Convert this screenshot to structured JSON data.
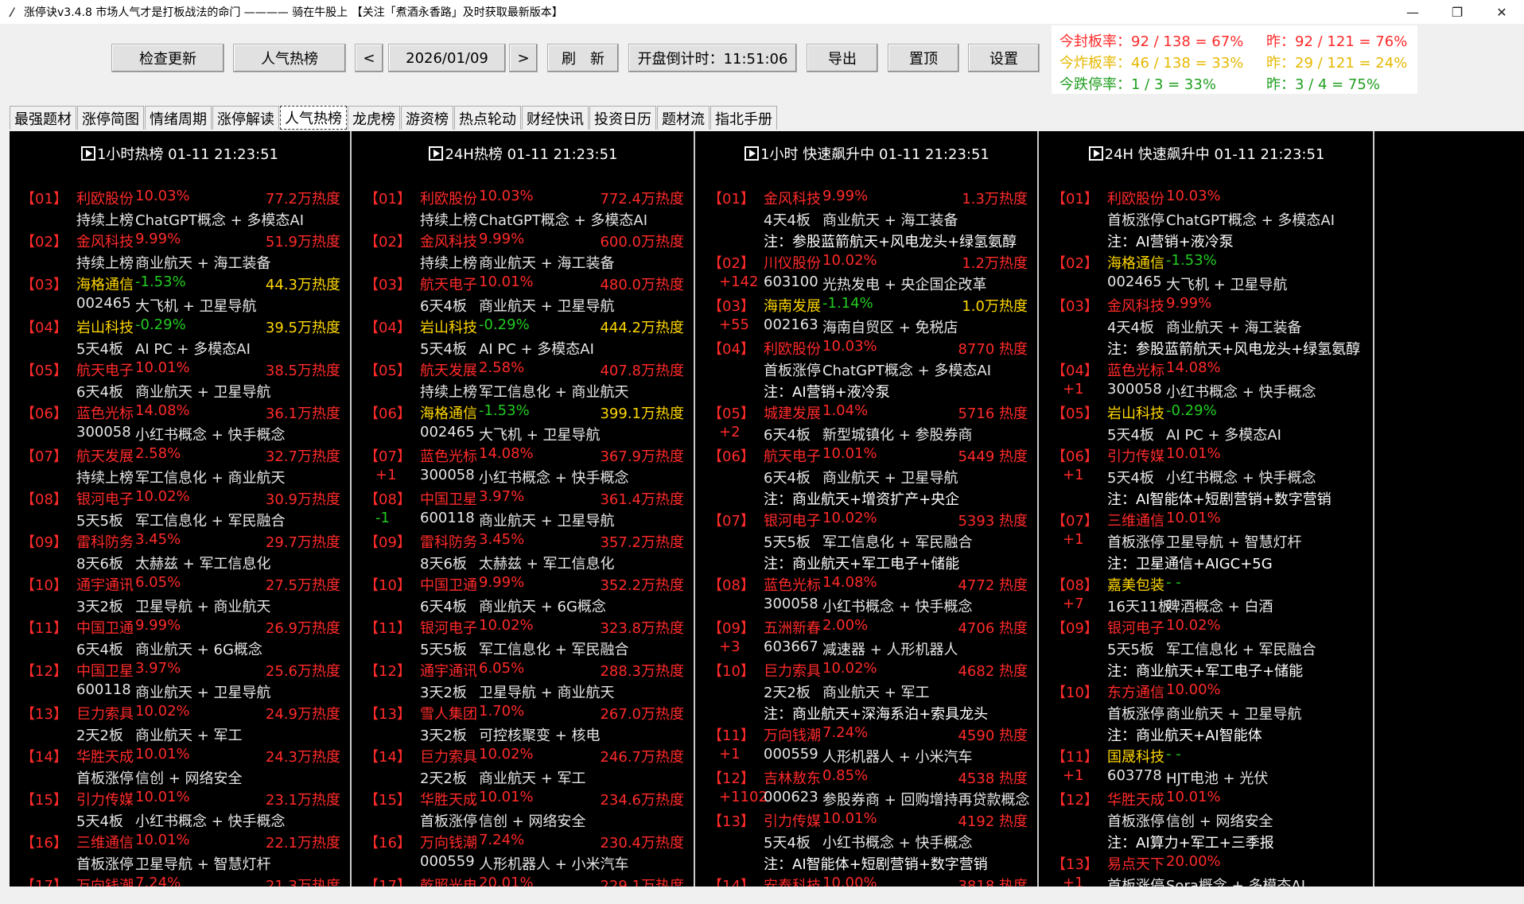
{
  "window": {
    "title": "涨停诀v3.4.8 市场人气才是打板战法的命门 ———— 骑在牛股上 【关注「煮酒永香路」及时获取最新版本】",
    "minimize": "—",
    "maximize": "❐",
    "close": "✕"
  },
  "toolbar": {
    "check_update": "检查更新",
    "popular": "人气热榜",
    "prev": "<",
    "date": "2026/01/09",
    "next": ">",
    "refresh": "刷　新",
    "countdown": "开盘倒计时：11:51:06",
    "export": "导出",
    "pin": "置顶",
    "settings": "设置"
  },
  "stats": {
    "seal_today": "今封板率：92 / 138 = 67%",
    "seal_prev": "昨：92 / 121 = 76%",
    "burst_today": "今炸板率：46 / 138 = 33%",
    "burst_prev": "昨：29 / 121 = 24%",
    "drop_today": "今跌停率：1 / 3 = 33%",
    "drop_prev": "昨：3 / 4 = 75%",
    "colors": {
      "seal": "#ff2a2a",
      "burst": "#e6b800",
      "drop": "#1f9e1f"
    }
  },
  "tabs": [
    "最强题材",
    "涨停简图",
    "情绪周期",
    "涨停解读",
    "人气热榜",
    "龙虎榜",
    "游资榜",
    "热点轮动",
    "财经快讯",
    "投资日历",
    "题材流",
    "指北手册"
  ],
  "active_tab": "人气热榜",
  "panels": [
    {
      "head": "1小时热榜  01-11  21:23:51",
      "entries": [
        {
          "rank": "【01】",
          "name": "利欧股份",
          "pct": "10.03%",
          "heat": "77.2万热度",
          "sub1": "持续上榜",
          "sub2": "ChatGPT概念 + 多模态AI"
        },
        {
          "rank": "【02】",
          "name": "金风科技",
          "pct": "9.99%",
          "heat": "51.9万热度",
          "sub1": "持续上榜",
          "sub2": "商业航天 + 海工装备"
        },
        {
          "rank": "【03】",
          "name": "海格通信",
          "pct": "-1.53%",
          "heat": "44.3万热度",
          "sub1": "002465",
          "sub2": "大飞机 + 卫星导航"
        },
        {
          "rank": "【04】",
          "name": "岩山科技",
          "pct": "-0.29%",
          "heat": "39.5万热度",
          "sub1": "5天4板",
          "sub2": "AI PC + 多模态AI"
        },
        {
          "rank": "【05】",
          "name": "航天电子",
          "pct": "10.01%",
          "heat": "38.5万热度",
          "sub1": "6天4板",
          "sub2": "商业航天 + 卫星导航"
        },
        {
          "rank": "【06】",
          "name": "蓝色光标",
          "pct": "14.08%",
          "heat": "36.1万热度",
          "sub1": "300058",
          "sub2": "小红书概念 + 快手概念"
        },
        {
          "rank": "【07】",
          "name": "航天发展",
          "pct": "2.58%",
          "heat": "32.7万热度",
          "sub1": "持续上榜",
          "sub2": "军工信息化 + 商业航天"
        },
        {
          "rank": "【08】",
          "name": "银河电子",
          "pct": "10.02%",
          "heat": "30.9万热度",
          "sub1": "5天5板",
          "sub2": "军工信息化 + 军民融合"
        },
        {
          "rank": "【09】",
          "name": "雷科防务",
          "pct": "3.45%",
          "heat": "29.7万热度",
          "sub1": "8天6板",
          "sub2": "太赫兹 + 军工信息化"
        },
        {
          "rank": "【10】",
          "name": "通宇通讯",
          "pct": "6.05%",
          "heat": "27.5万热度",
          "sub1": "3天2板",
          "sub2": "卫星导航 + 商业航天"
        },
        {
          "rank": "【11】",
          "name": "中国卫通",
          "pct": "9.99%",
          "heat": "26.9万热度",
          "sub1": "6天4板",
          "sub2": "商业航天 + 6G概念"
        },
        {
          "rank": "【12】",
          "name": "中国卫星",
          "pct": "3.97%",
          "heat": "25.6万热度",
          "sub1": "600118",
          "sub2": "商业航天 + 卫星导航"
        },
        {
          "rank": "【13】",
          "name": "巨力索具",
          "pct": "10.02%",
          "heat": "24.9万热度",
          "sub1": "2天2板",
          "sub2": "商业航天 + 军工"
        },
        {
          "rank": "【14】",
          "name": "华胜天成",
          "pct": "10.01%",
          "heat": "24.3万热度",
          "sub1": "首板涨停",
          "sub2": "信创 + 网络安全"
        },
        {
          "rank": "【15】",
          "name": "引力传媒",
          "pct": "10.01%",
          "heat": "23.1万热度",
          "sub1": "5天4板",
          "sub2": "小红书概念 + 快手概念"
        },
        {
          "rank": "【16】",
          "name": "三维通信",
          "pct": "10.01%",
          "heat": "22.1万热度",
          "sub1": "首板涨停",
          "sub2": "卫星导航 + 智慧灯杆"
        },
        {
          "rank": "【17】",
          "name": "万向钱潮",
          "pct": "7.24%",
          "heat": "21.3万热度",
          "sub1": "",
          "sub2": ""
        }
      ]
    },
    {
      "head": "24H热榜  01-11  21:23:51",
      "entries": [
        {
          "rank": "【01】",
          "name": "利欧股份",
          "pct": "10.03%",
          "heat": "772.4万热度",
          "sub1": "持续上榜",
          "sub2": "ChatGPT概念 + 多模态AI"
        },
        {
          "rank": "【02】",
          "name": "金风科技",
          "pct": "9.99%",
          "heat": "600.0万热度",
          "sub1": "持续上榜",
          "sub2": "商业航天 + 海工装备"
        },
        {
          "rank": "【03】",
          "name": "航天电子",
          "pct": "10.01%",
          "heat": "480.0万热度",
          "sub1": "6天4板",
          "sub2": "商业航天 + 卫星导航"
        },
        {
          "rank": "【04】",
          "name": "岩山科技",
          "pct": "-0.29%",
          "heat": "444.2万热度",
          "sub1": "5天4板",
          "sub2": "AI PC + 多模态AI"
        },
        {
          "rank": "【05】",
          "name": "航天发展",
          "pct": "2.58%",
          "heat": "407.8万热度",
          "sub1": "持续上榜",
          "sub2": "军工信息化 + 商业航天"
        },
        {
          "rank": "【06】",
          "name": "海格通信",
          "pct": "-1.53%",
          "heat": "399.1万热度",
          "sub1": "002465",
          "sub2": "大飞机 + 卫星导航"
        },
        {
          "rank": "【07】",
          "name": "蓝色光标",
          "pct": "14.08%",
          "heat": "367.9万热度",
          "delta": "+1",
          "sub1": "300058",
          "sub2": "小红书概念 + 快手概念"
        },
        {
          "rank": "【08】",
          "name": "中国卫星",
          "pct": "3.97%",
          "heat": "361.4万热度",
          "delta": "-1",
          "sub1": "600118",
          "sub2": "商业航天 + 卫星导航"
        },
        {
          "rank": "【09】",
          "name": "雷科防务",
          "pct": "3.45%",
          "heat": "357.2万热度",
          "sub1": "8天6板",
          "sub2": "太赫兹 + 军工信息化"
        },
        {
          "rank": "【10】",
          "name": "中国卫通",
          "pct": "9.99%",
          "heat": "352.2万热度",
          "sub1": "6天4板",
          "sub2": "商业航天 + 6G概念"
        },
        {
          "rank": "【11】",
          "name": "银河电子",
          "pct": "10.02%",
          "heat": "323.8万热度",
          "sub1": "5天5板",
          "sub2": "军工信息化 + 军民融合"
        },
        {
          "rank": "【12】",
          "name": "通宇通讯",
          "pct": "6.05%",
          "heat": "288.3万热度",
          "sub1": "3天2板",
          "sub2": "卫星导航 + 商业航天"
        },
        {
          "rank": "【13】",
          "name": "雪人集团",
          "pct": "1.70%",
          "heat": "267.0万热度",
          "sub1": "3天2板",
          "sub2": "可控核聚变 + 核电"
        },
        {
          "rank": "【14】",
          "name": "巨力索具",
          "pct": "10.02%",
          "heat": "246.7万热度",
          "sub1": "2天2板",
          "sub2": "商业航天 + 军工"
        },
        {
          "rank": "【15】",
          "name": "华胜天成",
          "pct": "10.01%",
          "heat": "234.6万热度",
          "sub1": "首板涨停",
          "sub2": "信创 + 网络安全"
        },
        {
          "rank": "【16】",
          "name": "万向钱潮",
          "pct": "7.24%",
          "heat": "230.4万热度",
          "sub1": "000559",
          "sub2": "人形机器人 + 小米汽车"
        },
        {
          "rank": "【17】",
          "name": "乾照光电",
          "pct": "20.01%",
          "heat": "229.1万热度",
          "sub1": "",
          "sub2": ""
        }
      ]
    },
    {
      "head": "1小时 快速飙升中  01-11  21:23:51",
      "entries": [
        {
          "rank": "【01】",
          "name": "金风科技",
          "pct": "9.99%",
          "heat": "1.3万热度",
          "sub1": "4天4板",
          "sub2": "商业航天 + 海工装备",
          "note": "注：参股蓝箭航天+风电龙头+绿氢氨醇"
        },
        {
          "rank": "【02】",
          "name": "川仪股份",
          "pct": "10.02%",
          "heat": "1.2万热度",
          "delta": "+142",
          "sub1": "603100",
          "sub2": "光热发电 + 央企国企改革"
        },
        {
          "rank": "【03】",
          "name": "海南发展",
          "pct": "-1.14%",
          "heat": "1.0万热度",
          "delta": "+55",
          "sub1": "002163",
          "sub2": "海南自贸区 + 免税店"
        },
        {
          "rank": "【04】",
          "name": "利欧股份",
          "pct": "10.03%",
          "heat": "8770 热度",
          "sub1": "首板涨停",
          "sub2": "ChatGPT概念 + 多模态AI",
          "note": "注：AI营销+液冷泵"
        },
        {
          "rank": "【05】",
          "name": "城建发展",
          "pct": "1.04%",
          "heat": "5716 热度",
          "delta": "+2",
          "sub1": "6天4板",
          "sub2": "新型城镇化 + 参股券商"
        },
        {
          "rank": "【06】",
          "name": "航天电子",
          "pct": "10.01%",
          "heat": "5449 热度",
          "sub1": "6天4板",
          "sub2": "商业航天 + 卫星导航",
          "note": "注：商业航天+增资扩产+央企"
        },
        {
          "rank": "【07】",
          "name": "银河电子",
          "pct": "10.02%",
          "heat": "5393 热度",
          "sub1": "5天5板",
          "sub2": "军工信息化 + 军民融合",
          "note": "注：商业航天+军工电子+储能"
        },
        {
          "rank": "【08】",
          "name": "蓝色光标",
          "pct": "14.08%",
          "heat": "4772 热度",
          "sub1": "300058",
          "sub2": "小红书概念 + 快手概念"
        },
        {
          "rank": "【09】",
          "name": "五洲新春",
          "pct": "2.00%",
          "heat": "4706 热度",
          "delta": "+3",
          "sub1": "603667",
          "sub2": "减速器 + 人形机器人"
        },
        {
          "rank": "【10】",
          "name": "巨力索具",
          "pct": "10.02%",
          "heat": "4682 热度",
          "sub1": "2天2板",
          "sub2": "商业航天 + 军工",
          "note": "注：商业航天+深海系泊+索具龙头"
        },
        {
          "rank": "【11】",
          "name": "万向钱潮",
          "pct": "7.24%",
          "heat": "4590 热度",
          "delta": "+1",
          "sub1": "000559",
          "sub2": "人形机器人 + 小米汽车"
        },
        {
          "rank": "【12】",
          "name": "吉林敖东",
          "pct": "0.85%",
          "heat": "4538 热度",
          "delta": "+1102",
          "sub1": "000623",
          "sub2": "参股券商 + 回购增持再贷款概念"
        },
        {
          "rank": "【13】",
          "name": "引力传媒",
          "pct": "10.01%",
          "heat": "4192 热度",
          "sub1": "5天4板",
          "sub2": "小红书概念 + 快手概念",
          "note": "注：AI智能体+短剧营销+数字营销"
        },
        {
          "rank": "【14】",
          "name": "安泰科技",
          "pct": "10.00%",
          "heat": "3818 热度",
          "sub1": "",
          "sub2": ""
        }
      ]
    },
    {
      "head": "24H 快速飙升中  01-11  21:23:51",
      "entries": [
        {
          "rank": "【01】",
          "name": "利欧股份",
          "pct": "10.03%",
          "heat": "",
          "sub1": "首板涨停",
          "sub2": "ChatGPT概念 + 多模态AI",
          "note": "注：AI营销+液冷泵"
        },
        {
          "rank": "【02】",
          "name": "海格通信",
          "pct": "-1.53%",
          "heat": "",
          "sub1": "002465",
          "sub2": "大飞机 + 卫星导航"
        },
        {
          "rank": "【03】",
          "name": "金风科技",
          "pct": "9.99%",
          "heat": "",
          "sub1": "4天4板",
          "sub2": "商业航天 + 海工装备",
          "note": "注：参股蓝箭航天+风电龙头+绿氢氨醇"
        },
        {
          "rank": "【04】",
          "name": "蓝色光标",
          "pct": "14.08%",
          "heat": "",
          "delta": "+1",
          "sub1": "300058",
          "sub2": "小红书概念 + 快手概念"
        },
        {
          "rank": "【05】",
          "name": "岩山科技",
          "pct": "-0.29%",
          "heat": "",
          "sub1": "5天4板",
          "sub2": "AI PC + 多模态AI"
        },
        {
          "rank": "【06】",
          "name": "引力传媒",
          "pct": "10.01%",
          "heat": "",
          "delta": "+1",
          "sub1": "5天4板",
          "sub2": "小红书概念 + 快手概念",
          "note": "注：AI智能体+短剧营销+数字营销"
        },
        {
          "rank": "【07】",
          "name": "三维通信",
          "pct": "10.01%",
          "heat": "",
          "delta": "+1",
          "sub1": "首板涨停",
          "sub2": "卫星导航 + 智慧灯杆",
          "note": "注：卫星通信+AIGC+5G"
        },
        {
          "rank": "【08】",
          "name": "嘉美包装",
          "pct": "- -",
          "heat": "",
          "delta": "+7",
          "sub1": "16天11板",
          "sub2": "啤酒概念 + 白酒"
        },
        {
          "rank": "【09】",
          "name": "银河电子",
          "pct": "10.02%",
          "heat": "",
          "sub1": "5天5板",
          "sub2": "军工信息化 + 军民融合",
          "note": "注：商业航天+军工电子+储能"
        },
        {
          "rank": "【10】",
          "name": "东方通信",
          "pct": "10.00%",
          "heat": "",
          "sub1": "首板涨停",
          "sub2": "商业航天 + 卫星导航",
          "note": "注：商业航天+AI智能体"
        },
        {
          "rank": "【11】",
          "name": "国晟科技",
          "pct": "- -",
          "heat": "",
          "delta": "+1",
          "sub1": "603778",
          "sub2": "HJT电池 + 光伏"
        },
        {
          "rank": "【12】",
          "name": "华胜天成",
          "pct": "10.01%",
          "heat": "",
          "sub1": "首板涨停",
          "sub2": "信创 + 网络安全",
          "note": "注：AI算力+军工+三季报"
        },
        {
          "rank": "【13】",
          "name": "易点天下",
          "pct": "20.00%",
          "heat": "",
          "delta": "+1",
          "sub1": "首板涨停",
          "sub2": "Sora概念 + 多模态AI"
        }
      ]
    }
  ]
}
